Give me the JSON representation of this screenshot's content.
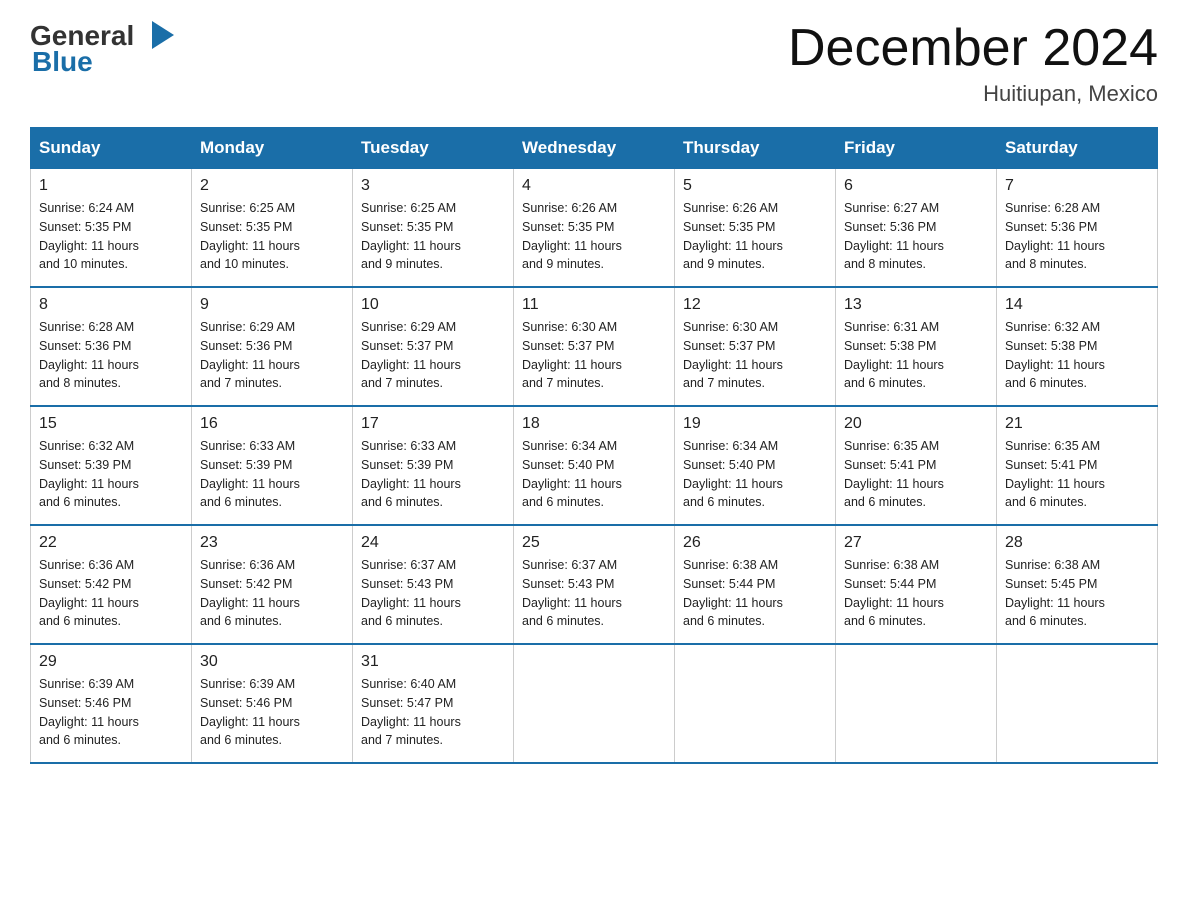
{
  "logo": {
    "general": "General",
    "blue": "Blue"
  },
  "title": "December 2024",
  "location": "Huitiupan, Mexico",
  "weekdays": [
    "Sunday",
    "Monday",
    "Tuesday",
    "Wednesday",
    "Thursday",
    "Friday",
    "Saturday"
  ],
  "weeks": [
    [
      {
        "day": "1",
        "sunrise": "6:24 AM",
        "sunset": "5:35 PM",
        "daylight": "11 hours and 10 minutes."
      },
      {
        "day": "2",
        "sunrise": "6:25 AM",
        "sunset": "5:35 PM",
        "daylight": "11 hours and 10 minutes."
      },
      {
        "day": "3",
        "sunrise": "6:25 AM",
        "sunset": "5:35 PM",
        "daylight": "11 hours and 9 minutes."
      },
      {
        "day": "4",
        "sunrise": "6:26 AM",
        "sunset": "5:35 PM",
        "daylight": "11 hours and 9 minutes."
      },
      {
        "day": "5",
        "sunrise": "6:26 AM",
        "sunset": "5:35 PM",
        "daylight": "11 hours and 9 minutes."
      },
      {
        "day": "6",
        "sunrise": "6:27 AM",
        "sunset": "5:36 PM",
        "daylight": "11 hours and 8 minutes."
      },
      {
        "day": "7",
        "sunrise": "6:28 AM",
        "sunset": "5:36 PM",
        "daylight": "11 hours and 8 minutes."
      }
    ],
    [
      {
        "day": "8",
        "sunrise": "6:28 AM",
        "sunset": "5:36 PM",
        "daylight": "11 hours and 8 minutes."
      },
      {
        "day": "9",
        "sunrise": "6:29 AM",
        "sunset": "5:36 PM",
        "daylight": "11 hours and 7 minutes."
      },
      {
        "day": "10",
        "sunrise": "6:29 AM",
        "sunset": "5:37 PM",
        "daylight": "11 hours and 7 minutes."
      },
      {
        "day": "11",
        "sunrise": "6:30 AM",
        "sunset": "5:37 PM",
        "daylight": "11 hours and 7 minutes."
      },
      {
        "day": "12",
        "sunrise": "6:30 AM",
        "sunset": "5:37 PM",
        "daylight": "11 hours and 7 minutes."
      },
      {
        "day": "13",
        "sunrise": "6:31 AM",
        "sunset": "5:38 PM",
        "daylight": "11 hours and 6 minutes."
      },
      {
        "day": "14",
        "sunrise": "6:32 AM",
        "sunset": "5:38 PM",
        "daylight": "11 hours and 6 minutes."
      }
    ],
    [
      {
        "day": "15",
        "sunrise": "6:32 AM",
        "sunset": "5:39 PM",
        "daylight": "11 hours and 6 minutes."
      },
      {
        "day": "16",
        "sunrise": "6:33 AM",
        "sunset": "5:39 PM",
        "daylight": "11 hours and 6 minutes."
      },
      {
        "day": "17",
        "sunrise": "6:33 AM",
        "sunset": "5:39 PM",
        "daylight": "11 hours and 6 minutes."
      },
      {
        "day": "18",
        "sunrise": "6:34 AM",
        "sunset": "5:40 PM",
        "daylight": "11 hours and 6 minutes."
      },
      {
        "day": "19",
        "sunrise": "6:34 AM",
        "sunset": "5:40 PM",
        "daylight": "11 hours and 6 minutes."
      },
      {
        "day": "20",
        "sunrise": "6:35 AM",
        "sunset": "5:41 PM",
        "daylight": "11 hours and 6 minutes."
      },
      {
        "day": "21",
        "sunrise": "6:35 AM",
        "sunset": "5:41 PM",
        "daylight": "11 hours and 6 minutes."
      }
    ],
    [
      {
        "day": "22",
        "sunrise": "6:36 AM",
        "sunset": "5:42 PM",
        "daylight": "11 hours and 6 minutes."
      },
      {
        "day": "23",
        "sunrise": "6:36 AM",
        "sunset": "5:42 PM",
        "daylight": "11 hours and 6 minutes."
      },
      {
        "day": "24",
        "sunrise": "6:37 AM",
        "sunset": "5:43 PM",
        "daylight": "11 hours and 6 minutes."
      },
      {
        "day": "25",
        "sunrise": "6:37 AM",
        "sunset": "5:43 PM",
        "daylight": "11 hours and 6 minutes."
      },
      {
        "day": "26",
        "sunrise": "6:38 AM",
        "sunset": "5:44 PM",
        "daylight": "11 hours and 6 minutes."
      },
      {
        "day": "27",
        "sunrise": "6:38 AM",
        "sunset": "5:44 PM",
        "daylight": "11 hours and 6 minutes."
      },
      {
        "day": "28",
        "sunrise": "6:38 AM",
        "sunset": "5:45 PM",
        "daylight": "11 hours and 6 minutes."
      }
    ],
    [
      {
        "day": "29",
        "sunrise": "6:39 AM",
        "sunset": "5:46 PM",
        "daylight": "11 hours and 6 minutes."
      },
      {
        "day": "30",
        "sunrise": "6:39 AM",
        "sunset": "5:46 PM",
        "daylight": "11 hours and 6 minutes."
      },
      {
        "day": "31",
        "sunrise": "6:40 AM",
        "sunset": "5:47 PM",
        "daylight": "11 hours and 7 minutes."
      },
      null,
      null,
      null,
      null
    ]
  ],
  "labels": {
    "sunrise": "Sunrise:",
    "sunset": "Sunset:",
    "daylight": "Daylight:"
  }
}
